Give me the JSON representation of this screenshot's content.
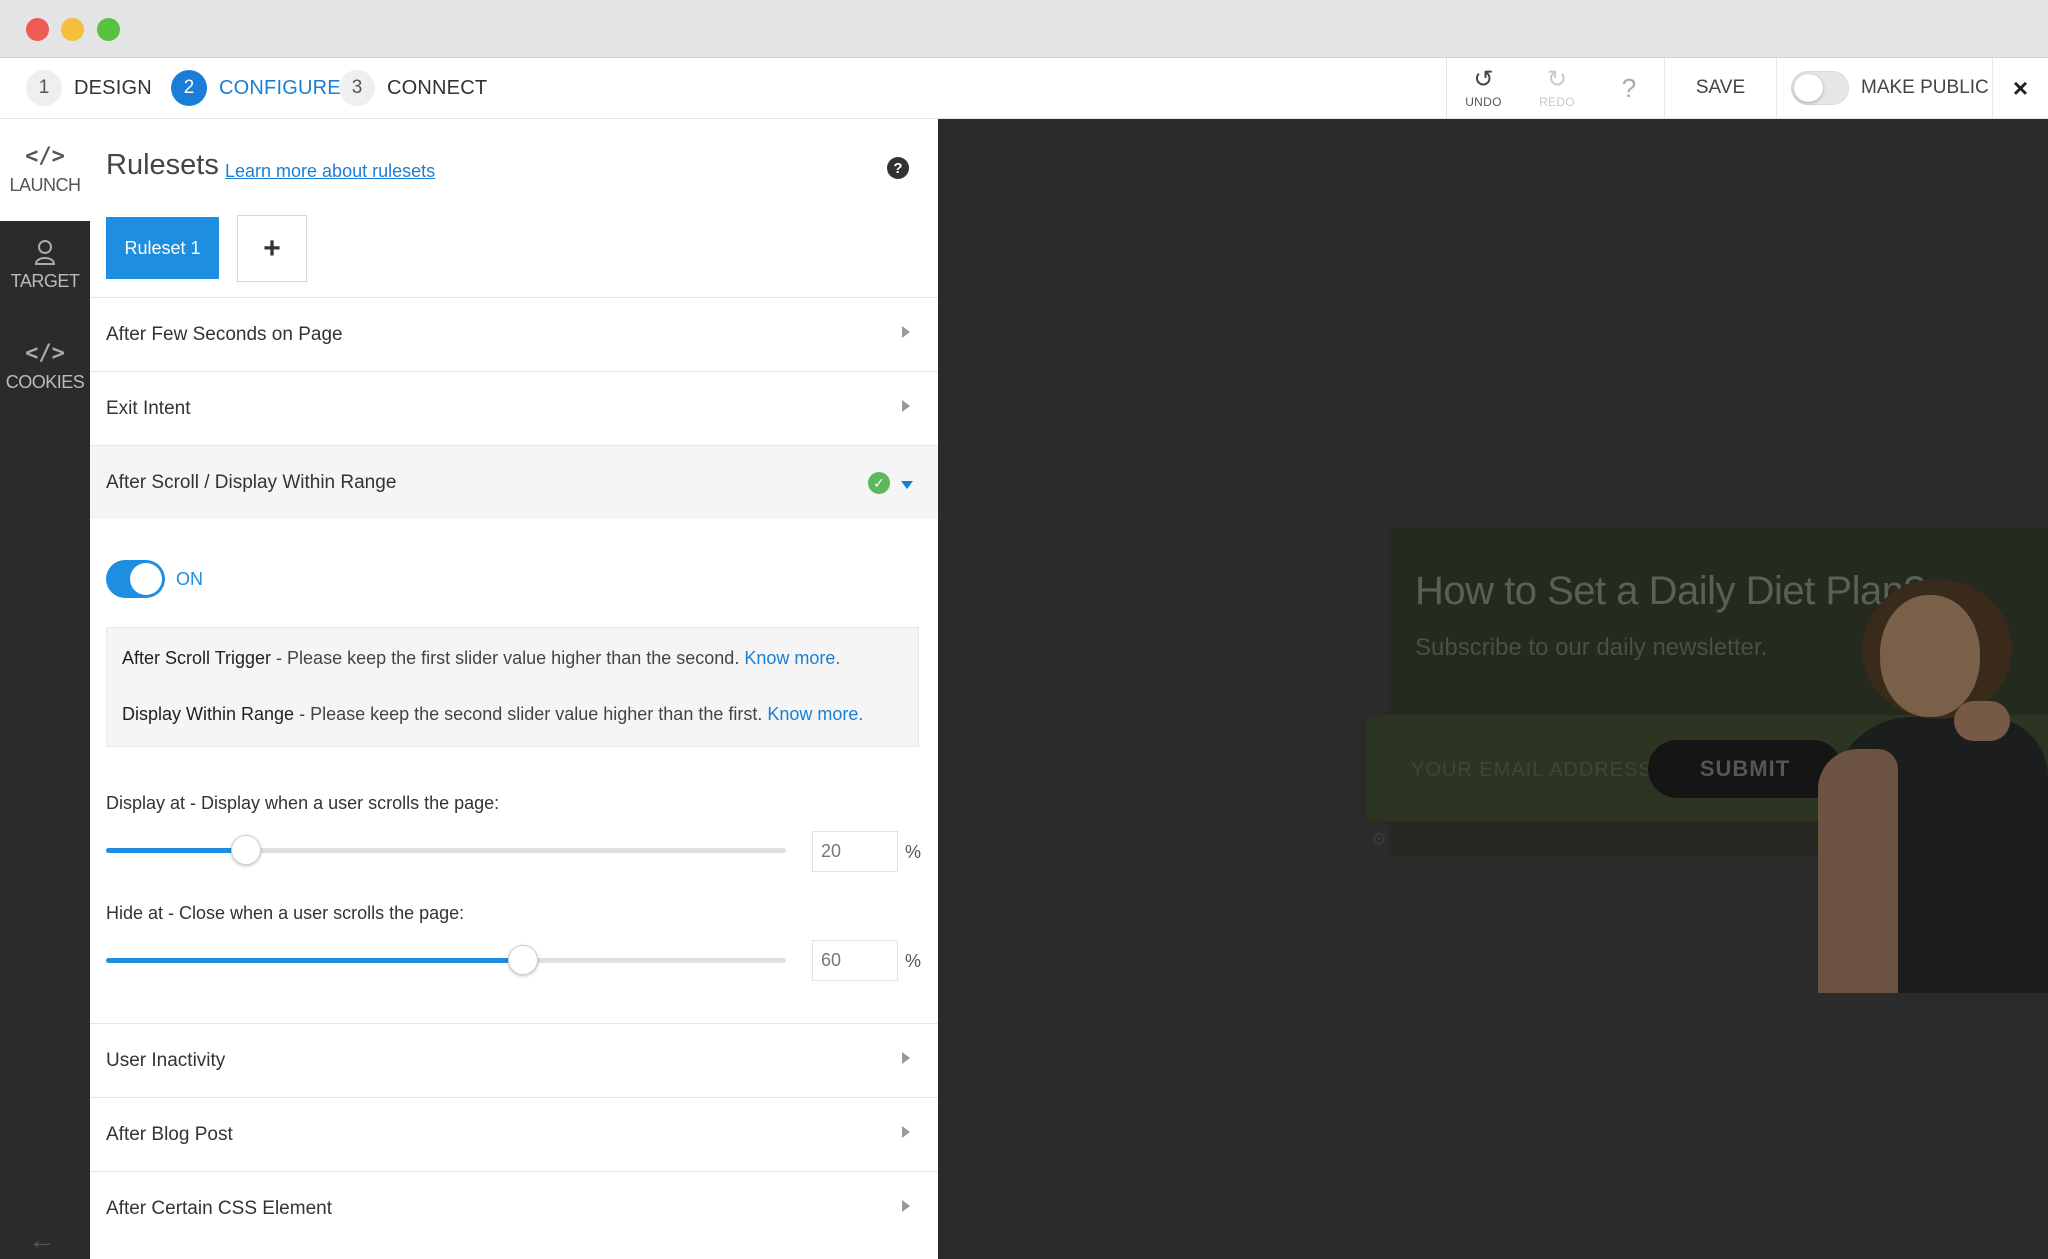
{
  "window": {
    "controls": [
      "close",
      "minimize",
      "maximize"
    ]
  },
  "steps": [
    {
      "num": "1",
      "label": "DESIGN"
    },
    {
      "num": "2",
      "label": "CONFIGURE"
    },
    {
      "num": "3",
      "label": "CONNECT"
    }
  ],
  "toolbar": {
    "undo_icon": "undo-icon",
    "undo_label": "UNDO",
    "redo_icon": "redo-icon",
    "redo_label": "REDO",
    "help": "?",
    "save_label": "SAVE",
    "make_public_label": "MAKE PUBLIC",
    "close": "×"
  },
  "rail": {
    "launch_icon": "</>",
    "launch_label": "LAUNCH",
    "target_label": "TARGET",
    "cookies_icon": "</>",
    "cookies_label": "COOKIES",
    "back_icon": "←"
  },
  "panel": {
    "title": "Rulesets",
    "link": "Learn more about rulesets",
    "help": "?",
    "tab": "Ruleset 1",
    "add": "+",
    "rows": [
      {
        "label": "After Few Seconds on Page"
      },
      {
        "label": "Exit Intent"
      },
      {
        "label": "After Scroll / Display Within Range"
      },
      {
        "label": "User Inactivity"
      },
      {
        "label": "After Blog Post"
      },
      {
        "label": "After Certain CSS Element"
      }
    ],
    "toggle_label": "ON",
    "info": {
      "line1_title": "After Scroll Trigger",
      "line1_text": " - Please keep the first slider value higher than the second. ",
      "line1_link": "Know more.",
      "line2_title": "Display Within Range",
      "line2_text": " - Please keep the second slider value higher than the first. ",
      "line2_link": "Know more."
    },
    "display_at": {
      "label": "Display at - Display when a user scrolls the page:",
      "value": "20",
      "unit": "%"
    },
    "hide_at": {
      "label": "Hide at - Close when a user scrolls the page:",
      "value": "60",
      "unit": "%"
    }
  },
  "preview": {
    "headline": "How to Set a Daily Diet Plan?",
    "subtitle": "Subscribe to our daily newsletter.",
    "email_placeholder": "YOUR EMAIL ADDRESS",
    "submit": "SUBMIT"
  },
  "colors": {
    "accent": "#1e8fe0",
    "success": "#5cb85c"
  }
}
